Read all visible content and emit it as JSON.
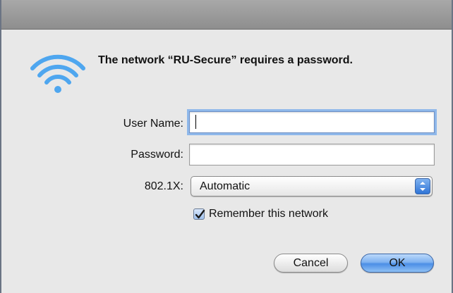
{
  "dialog": {
    "message": "The network “RU-Secure” requires a password.",
    "icon": "wifi-icon"
  },
  "form": {
    "username_label": "User Name:",
    "username_value": "",
    "password_label": "Password:",
    "password_value": "",
    "security_label": "802.1X:",
    "security_value": "Automatic",
    "remember_label": "Remember this network",
    "remember_checked": true
  },
  "buttons": {
    "cancel_label": "Cancel",
    "ok_label": "OK"
  },
  "colors": {
    "accent": "#3b84e0",
    "wifi": "#4ea6ef",
    "focus_ring": "#8fb8ea"
  }
}
